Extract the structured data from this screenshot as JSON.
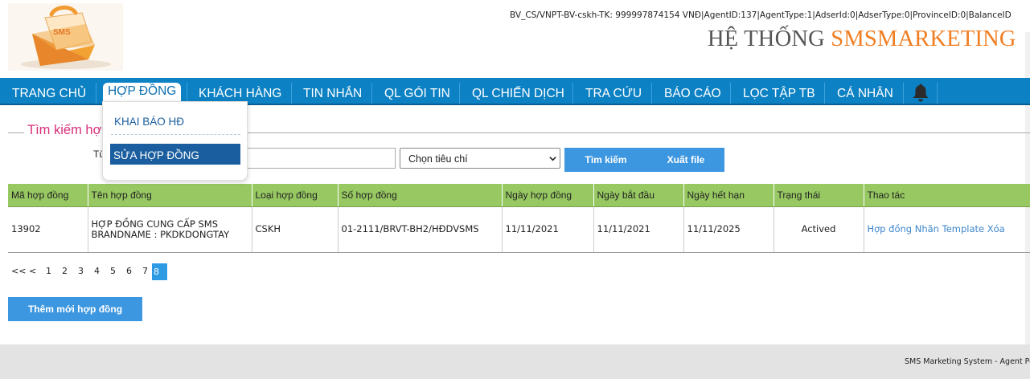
{
  "header": {
    "logo_text": "SMS",
    "account_info": "BV_CS/VNPT-BV-cskh-TK: 999997874154 VNĐ|AgentID:137|AgentType:1|AdserId:0|AdserType:0|ProvinceID:0|BalanceID",
    "system_title_prefix": "HỆ THỐNG ",
    "system_title_accent": "SMSMARKETING"
  },
  "nav": {
    "items": [
      {
        "label": "TRANG CHỦ"
      },
      {
        "label": "HỢP ĐỒNG"
      },
      {
        "label": "KHÁCH HÀNG"
      },
      {
        "label": "TIN NHẮN"
      },
      {
        "label": "QL GÓI TIN"
      },
      {
        "label": "QL CHIẾN DỊCH"
      },
      {
        "label": "TRA CỨU"
      },
      {
        "label": "BÁO CÁO"
      },
      {
        "label": "LỌC TẬP TB"
      },
      {
        "label": "CÁ NHÂN"
      }
    ],
    "active": "HỢP ĐỒNG",
    "bell_icon": "bell-icon"
  },
  "dropdown": {
    "items": [
      {
        "label": "KHAI BÁO HĐ"
      },
      {
        "label": "SỬA HỢP ĐỒNG"
      }
    ]
  },
  "search": {
    "legend": "Tìm kiếm hợp",
    "label": "Từ",
    "input_value": "",
    "criteria_selected": "Chọn tiêu chí",
    "search_button": "Tìm kiếm",
    "export_button": "Xuất file"
  },
  "table": {
    "columns": [
      "Mã hợp đồng",
      "Tên hợp đồng",
      "Loại hợp đồng",
      "Số hợp đồng",
      "Ngày hợp đồng",
      "Ngày bắt đầu",
      "Ngày hết hạn",
      "Trạng thái",
      "Thao tác"
    ],
    "rows": [
      {
        "code": "13902",
        "name": "HỢP ĐỒNG CUNG CẤP SMS BRANDNAME : PKDKDONGTAY",
        "type": "CSKH",
        "number": "01-2111/BRVT-BH2/HĐDVSMS",
        "contract_date": "11/11/2021",
        "start_date": "11/11/2021",
        "end_date": "11/11/2025",
        "status": "Actived",
        "actions": [
          "Hợp đồng",
          "Nhãn",
          "Template",
          "Xóa"
        ]
      }
    ]
  },
  "pagination": {
    "items": [
      "<<",
      "<",
      "1",
      "2",
      "3",
      "4",
      "5",
      "6",
      "7",
      "8"
    ],
    "current": "8"
  },
  "add_button": "Thêm mới hợp đồng",
  "footer": {
    "text": "SMS Marketing System - Agent Por"
  },
  "colors": {
    "nav_bg": "#0c81c3",
    "accent_orange": "#f07e22",
    "legend_pink": "#d6307a",
    "button_blue": "#3d97e0",
    "table_header_green": "#97c862",
    "dropdown_active": "#1b5e9f"
  }
}
